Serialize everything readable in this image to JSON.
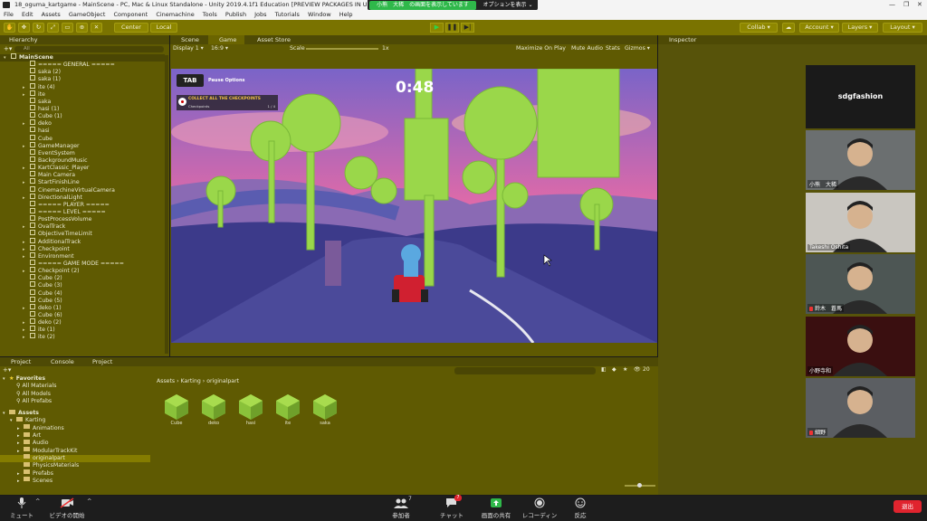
{
  "window": {
    "title": "18_oguma_kartgame - MainScene - PC, Mac & Linux Standalone - Unity 2019.4.1f1 Education [PREVIEW PACKAGES IN USE] <DX11>",
    "controls": [
      "—",
      "❐",
      "✕"
    ]
  },
  "menu": [
    "File",
    "Edit",
    "Assets",
    "GameObject",
    "Component",
    "Cinemachine",
    "Tools",
    "Publish",
    "Jobs",
    "Tutorials",
    "Window",
    "Help"
  ],
  "zoom_share": {
    "banner": "小熊　大稀　の画面を表示しています",
    "options": "オプションを表示 ⌄"
  },
  "toolbar": {
    "center": "Center",
    "local": "Local",
    "collab": "Collab ▾",
    "account": "Account ▾",
    "layers": "Layers ▾",
    "layout": "Layout ▾"
  },
  "hierarchy": {
    "tab": "Hierarchy",
    "search_placeholder": "All",
    "scene": "MainScene",
    "items": [
      {
        "name": "===== GENERAL =====",
        "arrow": false
      },
      {
        "name": "saka (2)",
        "arrow": false
      },
      {
        "name": "saka (1)",
        "arrow": false
      },
      {
        "name": "ite (4)",
        "arrow": true
      },
      {
        "name": "ite",
        "arrow": true
      },
      {
        "name": "saka",
        "arrow": false
      },
      {
        "name": "hasi (1)",
        "arrow": false
      },
      {
        "name": "Cube (1)",
        "arrow": false
      },
      {
        "name": "deko",
        "arrow": true
      },
      {
        "name": "hasi",
        "arrow": false
      },
      {
        "name": "Cube",
        "arrow": false
      },
      {
        "name": "GameManager",
        "arrow": true
      },
      {
        "name": "EventSystem",
        "arrow": false
      },
      {
        "name": "BackgroundMusic",
        "arrow": false
      },
      {
        "name": "KartClassic_Player",
        "arrow": true
      },
      {
        "name": "Main Camera",
        "arrow": false
      },
      {
        "name": "StartFinishLine",
        "arrow": true
      },
      {
        "name": "CinemachineVirtualCamera",
        "arrow": false
      },
      {
        "name": "DirectionalLight",
        "arrow": true
      },
      {
        "name": "===== PLAYER =====",
        "arrow": false
      },
      {
        "name": "===== LEVEL =====",
        "arrow": false
      },
      {
        "name": "PostProcessVolume",
        "arrow": false
      },
      {
        "name": "OvalTrack",
        "arrow": true
      },
      {
        "name": "ObjectiveTimeLimit",
        "arrow": false
      },
      {
        "name": "AdditionalTrack",
        "arrow": true
      },
      {
        "name": "Checkpoint",
        "arrow": true
      },
      {
        "name": "Environment",
        "arrow": true
      },
      {
        "name": "===== GAME MODE =====",
        "arrow": false
      },
      {
        "name": "Checkpoint (2)",
        "arrow": true
      },
      {
        "name": "Cube (2)",
        "arrow": false
      },
      {
        "name": "Cube (3)",
        "arrow": false
      },
      {
        "name": "Cube (4)",
        "arrow": false
      },
      {
        "name": "Cube (5)",
        "arrow": false
      },
      {
        "name": "deko (1)",
        "arrow": true
      },
      {
        "name": "Cube (6)",
        "arrow": false
      },
      {
        "name": "deko (2)",
        "arrow": true
      },
      {
        "name": "ite (1)",
        "arrow": true
      },
      {
        "name": "ite (2)",
        "arrow": true
      }
    ]
  },
  "game": {
    "tabs": [
      "Scene",
      "Game",
      "Asset Store"
    ],
    "display": "Display 1 ▾",
    "aspect": "16:9 ▾",
    "scale_label": "Scale",
    "scale_value": "1x",
    "maximize": "Maximize On Play",
    "mute": "Mute Audio",
    "stats": "Stats",
    "gizmos": "Gizmos ▾",
    "hud": {
      "tab": "TAB",
      "pause_options": "Pause Options",
      "timer": "0:48",
      "objective": "COLLECT ALL THE CHECKPOINTS",
      "objective_sub": "Checkpoints",
      "objective_count": "1 / 4"
    }
  },
  "inspector": {
    "tab": "Inspector"
  },
  "project": {
    "tabs": [
      "Project",
      "Console",
      "Project"
    ],
    "icon_count": "20",
    "favorites_label": "Favorites",
    "favorites": [
      "All Materials",
      "All Models",
      "All Prefabs"
    ],
    "assets_label": "Assets",
    "tree": [
      {
        "name": "Karting",
        "indent": 1,
        "arrow": "▾",
        "selected": false
      },
      {
        "name": "Animations",
        "indent": 2,
        "arrow": "▸",
        "selected": false
      },
      {
        "name": "Art",
        "indent": 2,
        "arrow": "▸",
        "selected": false
      },
      {
        "name": "Audio",
        "indent": 2,
        "arrow": "▸",
        "selected": false
      },
      {
        "name": "ModularTrackKit",
        "indent": 2,
        "arrow": "▸",
        "selected": false
      },
      {
        "name": "originalpart",
        "indent": 2,
        "arrow": "",
        "selected": true
      },
      {
        "name": "PhysicsMaterials",
        "indent": 2,
        "arrow": "",
        "selected": false
      },
      {
        "name": "Prefabs",
        "indent": 2,
        "arrow": "▸",
        "selected": false
      },
      {
        "name": "Scenes",
        "indent": 2,
        "arrow": "▸",
        "selected": false
      }
    ],
    "breadcrumb": "Assets  ›  Karting  ›  originalpart",
    "assets": [
      "Cube",
      "deko",
      "hasi",
      "ite",
      "saka"
    ]
  },
  "zoom": {
    "name_tile": "sdgfashion",
    "participants": [
      {
        "name": "小熊　大稀",
        "muted": false,
        "bg": "#6b6f70"
      },
      {
        "name": "Takeshi Oshita",
        "muted": false,
        "bg": "#c9c6c0"
      },
      {
        "name": "鈴木　蒼馬",
        "muted": true,
        "bg": "#4d5654"
      },
      {
        "name": "小野寺和",
        "muted": false,
        "bg": "#3a0f10"
      },
      {
        "name": "細野",
        "muted": true,
        "bg": "#5b5e62"
      }
    ],
    "bar": {
      "mute": "ミュート",
      "video": "ビデオの開始",
      "participants": "参加者",
      "participants_count": "7",
      "chat": "チャット",
      "chat_badge": "7",
      "share": "画面の共有",
      "record": "レコーディング",
      "reactions": "反応",
      "end": "退出"
    },
    "colors": {
      "share_green": "#2fb84a",
      "end_red": "#e0242e"
    }
  }
}
